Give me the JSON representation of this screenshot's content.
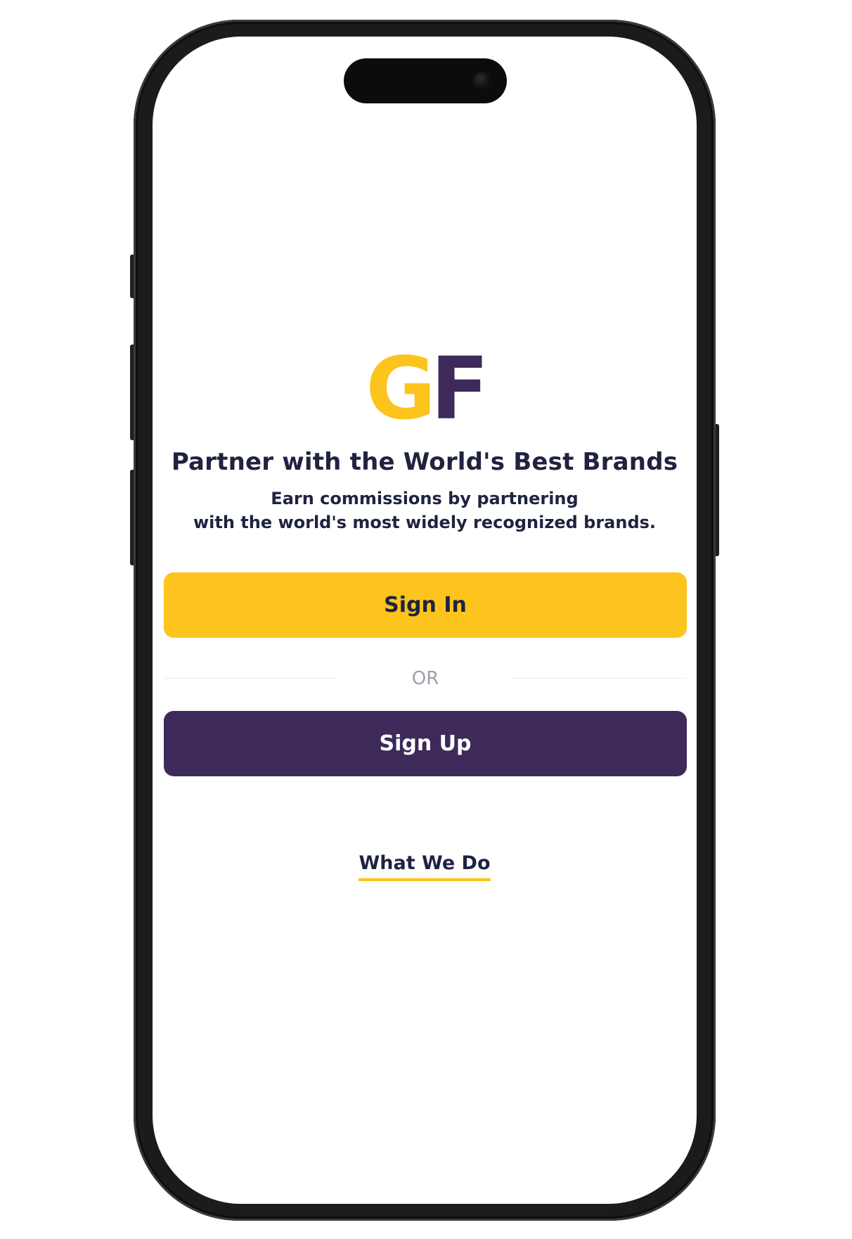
{
  "logo": {
    "letter_g": "G",
    "letter_f": "F"
  },
  "headline": "Partner with the World's Best Brands",
  "subheadline": {
    "line1": "Earn commissions by partnering",
    "line2": "with the world's most widely recognized brands."
  },
  "buttons": {
    "sign_in": "Sign In",
    "sign_up": "Sign Up"
  },
  "divider_text": "OR",
  "footer_link": "What We Do",
  "colors": {
    "brand_yellow": "#fcc41c",
    "brand_purple": "#3d2a5a",
    "text_dark": "#1f2340",
    "muted": "#9aa0a8"
  },
  "icons": [
    "dynamic-island-camera-icon"
  ]
}
